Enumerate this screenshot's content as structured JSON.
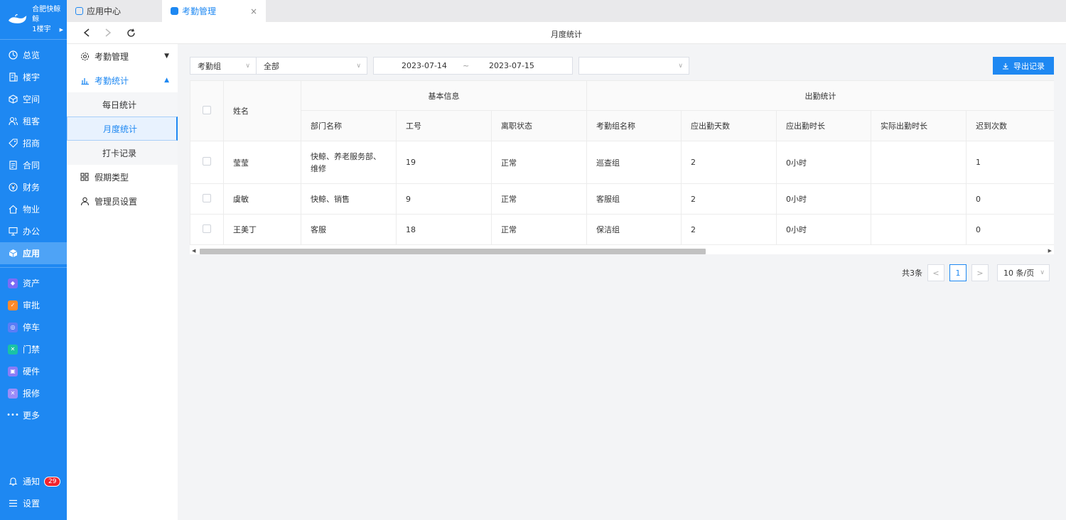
{
  "brand": {
    "name": "合肥快鲸鲸",
    "building": "1楼宇"
  },
  "nav": {
    "main": [
      {
        "label": "总览",
        "icon": "dashboard-icon"
      },
      {
        "label": "楼宇",
        "icon": "building-icon"
      },
      {
        "label": "空间",
        "icon": "cube-icon"
      },
      {
        "label": "租客",
        "icon": "users-icon"
      },
      {
        "label": "招商",
        "icon": "tag-icon"
      },
      {
        "label": "合同",
        "icon": "document-icon"
      },
      {
        "label": "财务",
        "icon": "finance-icon"
      },
      {
        "label": "物业",
        "icon": "home-icon"
      },
      {
        "label": "办公",
        "icon": "monitor-icon"
      },
      {
        "label": "应用",
        "icon": "app-cube-icon"
      }
    ],
    "apps": [
      {
        "label": "资产",
        "icon": "asset-icon",
        "color": "#7b6cf6"
      },
      {
        "label": "审批",
        "icon": "approval-icon",
        "color": "#ff8a2b"
      },
      {
        "label": "停车",
        "icon": "parking-icon",
        "color": "#5b7cf6"
      },
      {
        "label": "门禁",
        "icon": "access-icon",
        "color": "#19c2a5"
      },
      {
        "label": "硬件",
        "icon": "hardware-icon",
        "color": "#8a7cf7"
      },
      {
        "label": "报修",
        "icon": "repair-icon",
        "color": "#9b8cf8"
      }
    ],
    "more": "更多",
    "notify": {
      "label": "通知",
      "count": "29"
    },
    "settings": "设置"
  },
  "tabs": [
    {
      "label": "应用中心"
    },
    {
      "label": "考勤管理",
      "close": "×"
    }
  ],
  "toolbar": {
    "title": "月度统计"
  },
  "submenu": {
    "attendance_manage": "考勤管理",
    "attendance_stats": "考勤统计",
    "daily": "每日统计",
    "monthly": "月度统计",
    "punch": "打卡记录",
    "holiday": "假期类型",
    "admin": "管理员设置"
  },
  "filters": {
    "group_label": "考勤组",
    "group_value": "全部",
    "date_start": "2023-07-14",
    "date_sep": "~",
    "date_end": "2023-07-15",
    "export": "导出记录"
  },
  "table": {
    "group_basic": "基本信息",
    "group_attend": "出勤统计",
    "columns": {
      "name": "姓名",
      "dept": "部门名称",
      "id": "工号",
      "status": "离职状态",
      "group": "考勤组名称",
      "days": "应出勤天数",
      "hours": "应出勤时长",
      "actual": "实际出勤时长",
      "late": "迟到次数"
    },
    "rows": [
      {
        "name": "莹莹",
        "dept": "快鲸、养老服务部、维修",
        "id": "19",
        "status": "正常",
        "group": "巡查组",
        "days": "2",
        "hours": "0小时",
        "actual": "",
        "late": "1"
      },
      {
        "name": "虞敏",
        "dept": "快鲸、销售",
        "id": "9",
        "status": "正常",
        "group": "客服组",
        "days": "2",
        "hours": "0小时",
        "actual": "",
        "late": "0"
      },
      {
        "name": "王美丁",
        "dept": "客服",
        "id": "18",
        "status": "正常",
        "group": "保洁组",
        "days": "2",
        "hours": "0小时",
        "actual": "",
        "late": "0"
      }
    ]
  },
  "pagination": {
    "total": "共3条",
    "current": "1",
    "page_size": "10 条/页"
  },
  "colors": {
    "primary": "#1e88f2",
    "badge": "#f5222d"
  }
}
